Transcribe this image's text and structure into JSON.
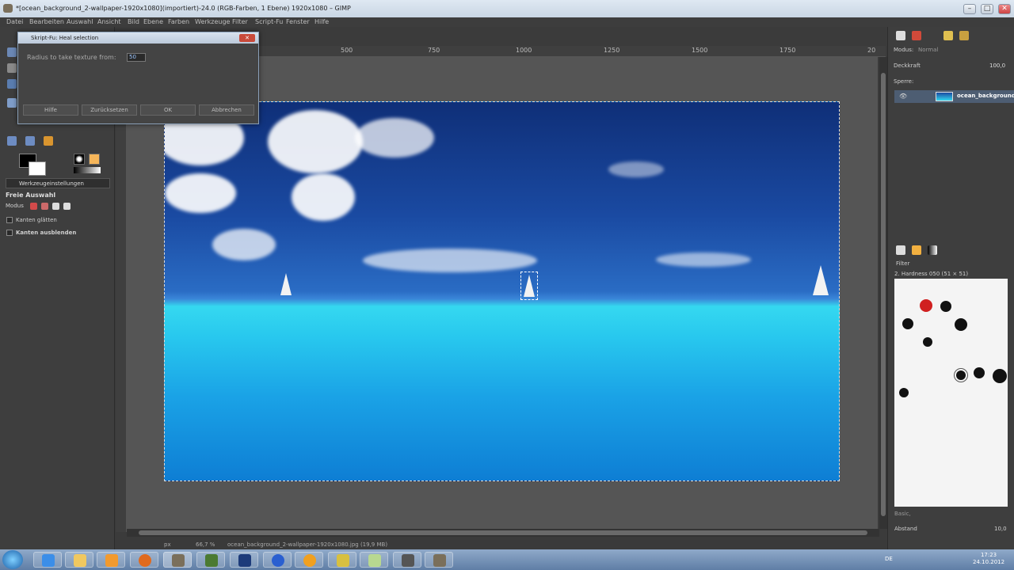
{
  "window": {
    "title": "*[ocean_background_2-wallpaper-1920x1080](importiert)-24.0 (RGB-Farben, 1 Ebene) 1920x1080 – GIMP",
    "minimize": "–",
    "maximize": "□",
    "close": "✕"
  },
  "menu": [
    "Datei",
    "Bearbeiten",
    "Auswahl",
    "Ansicht",
    "Bild",
    "Ebene",
    "Farben",
    "Werkzeuge",
    "Filter",
    "Script-Fu",
    "Fenster",
    "Hilfe"
  ],
  "toolbox": {
    "options_tab": "Werkzeugeinstellungen",
    "tool_name": "Freie Auswahl",
    "mode_label": "Modus",
    "antialias_label": "Kanten glätten",
    "feather_label": "Kanten ausblenden"
  },
  "ruler": {
    "ticks": [
      "500",
      "750",
      "1000",
      "1250",
      "1500",
      "1750",
      "20"
    ]
  },
  "status": {
    "unit": "px",
    "zoom": "66,7 %",
    "file": "ocean_background_2-wallpaper-1920x1080.jpg (19,9 MB)"
  },
  "dialog": {
    "title": "Skript-Fu: Heal selection",
    "close": "✕",
    "field_label": "Radius to take texture from:",
    "field_value": "50",
    "buttons": {
      "help": "Hilfe",
      "reset": "Zurücksetzen",
      "ok": "OK",
      "cancel": "Abbrechen"
    }
  },
  "layers": {
    "mode_label": "Modus:",
    "mode_value": "Normal",
    "opacity_label": "Deckkraft",
    "opacity_value": "100,0",
    "lock_label": "Sperre:",
    "layer_name": "ocean_background"
  },
  "brushes": {
    "filter_label": "Filter",
    "current_brush": "2. Hardness 050 (51 × 51)",
    "tag_value": "Basic,",
    "spacing_label": "Abstand",
    "spacing_value": "10,0"
  },
  "taskbar": {
    "keyboard": "DE",
    "time": "17:23",
    "date": "24.10.2012"
  }
}
